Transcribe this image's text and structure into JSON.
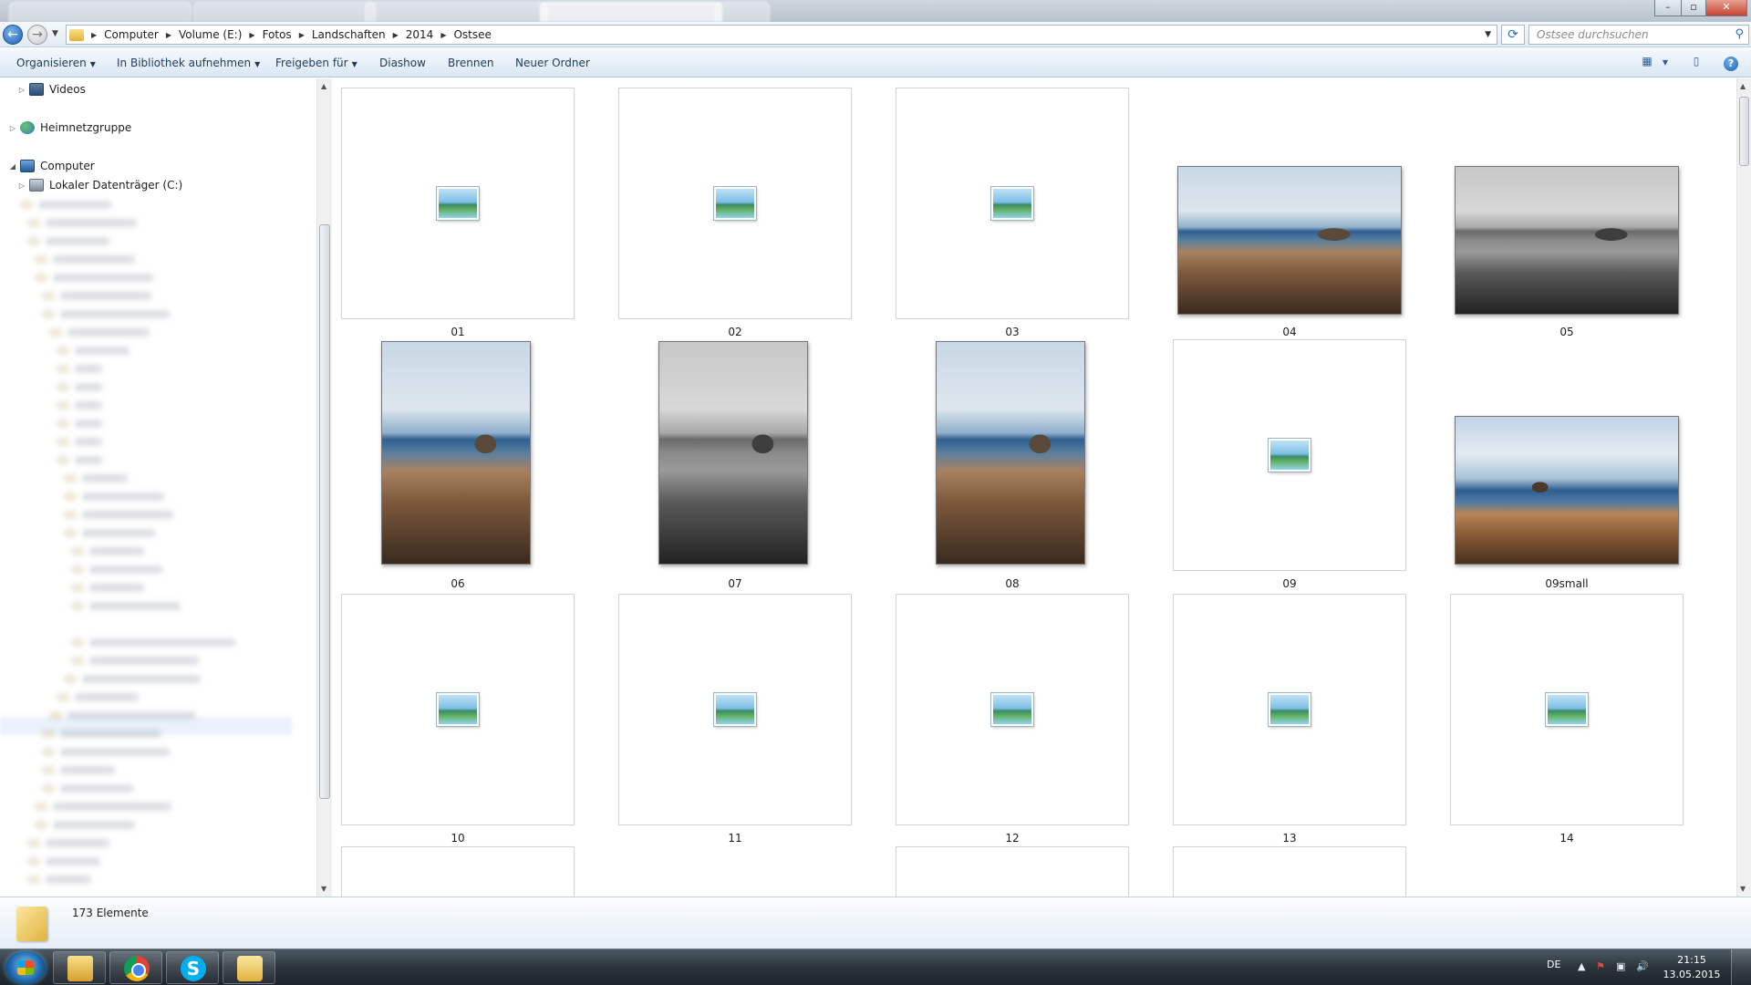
{
  "address": {
    "breadcrumbs": [
      "Computer",
      "Volume (E:)",
      "Fotos",
      "Landschaften",
      "2014",
      "Ostsee"
    ]
  },
  "search": {
    "placeholder": "Ostsee durchsuchen"
  },
  "toolbar": {
    "organize": "Organisieren",
    "library": "In Bibliothek aufnehmen",
    "share": "Freigeben für",
    "slideshow": "Diashow",
    "burn": "Brennen",
    "new_folder": "Neuer Ordner"
  },
  "nav": {
    "videos": "Videos",
    "homegroup": "Heimnetzgruppe",
    "computer": "Computer",
    "local_disk": "Lokaler Datenträger (C:)"
  },
  "files": [
    {
      "name": "01",
      "thumb": "placeholder"
    },
    {
      "name": "02",
      "thumb": "placeholder"
    },
    {
      "name": "03",
      "thumb": "placeholder"
    },
    {
      "name": "04",
      "thumb": "photo-color-landscape"
    },
    {
      "name": "05",
      "thumb": "photo-bw-landscape"
    },
    {
      "name": "06",
      "thumb": "photo-color-portrait"
    },
    {
      "name": "07",
      "thumb": "photo-bw-portrait"
    },
    {
      "name": "08",
      "thumb": "photo-color-portrait"
    },
    {
      "name": "09",
      "thumb": "placeholder"
    },
    {
      "name": "09small",
      "thumb": "photo-color-landscape"
    },
    {
      "name": "10",
      "thumb": "placeholder"
    },
    {
      "name": "11",
      "thumb": "placeholder"
    },
    {
      "name": "12",
      "thumb": "placeholder"
    },
    {
      "name": "13",
      "thumb": "placeholder"
    },
    {
      "name": "14",
      "thumb": "placeholder"
    }
  ],
  "status": {
    "item_count": "173 Elemente"
  },
  "taskbar": {
    "language": "DE",
    "time": "21:15",
    "date": "13.05.2015"
  },
  "colors": {
    "toolbar_text": "#1e3a5c",
    "accent": "#2a6fc3",
    "taskbar": "#2b333b"
  }
}
